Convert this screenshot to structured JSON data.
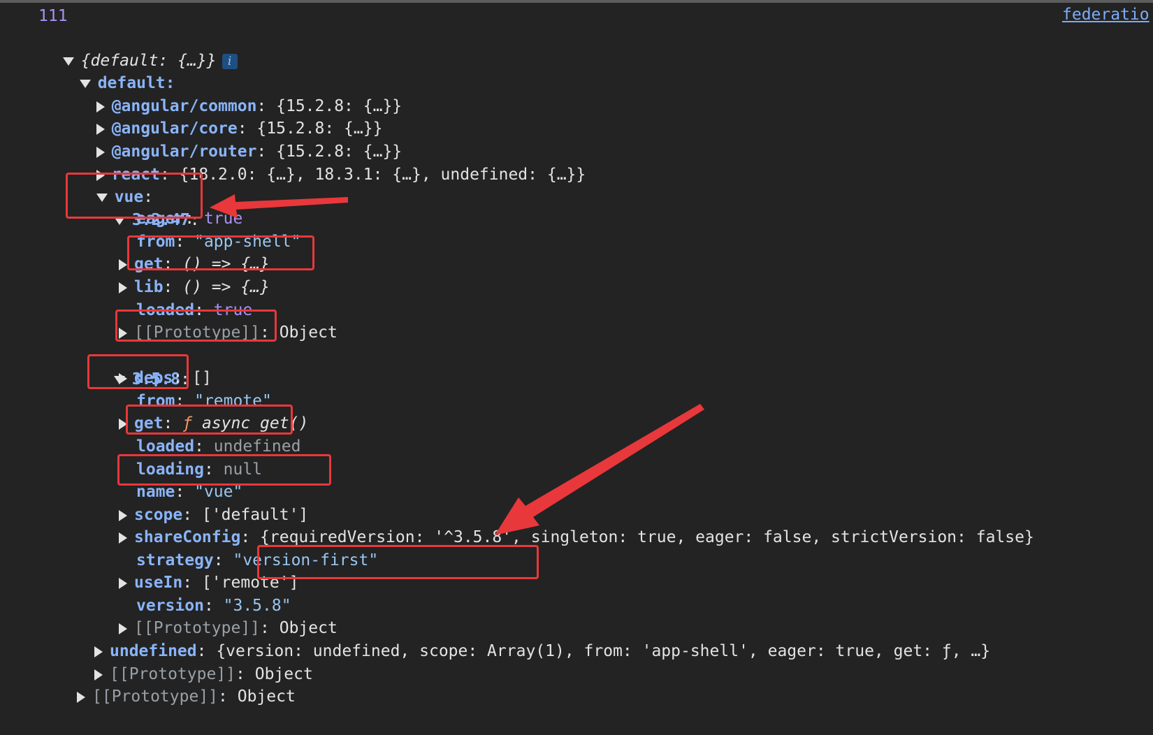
{
  "console": {
    "count": "111",
    "source_link": "federatio",
    "info_badge": "i"
  },
  "lines": [
    {
      "text": "{default: {…}}"
    },
    {
      "text": "default:"
    },
    {
      "key": "@angular/common",
      "value": "{15.2.8: {…}}"
    },
    {
      "key": "@angular/core",
      "value": "{15.2.8: {…}}"
    },
    {
      "key": "@angular/router",
      "value": "{15.2.8: {…}}"
    },
    {
      "key": "react",
      "value": "{18.2.0: {…}, 18.3.1: {…}, undefined: {…}}"
    },
    {
      "key": "vue"
    },
    {
      "key": "3.2.47"
    },
    {
      "key": "eager",
      "value": "true"
    },
    {
      "key": "from",
      "value": "\"app-shell\""
    },
    {
      "key": "get",
      "value": "() => {…}"
    },
    {
      "key": "lib",
      "value": "() => {…}"
    },
    {
      "key": "loaded",
      "value": "true"
    },
    {
      "key": "[[Prototype]]",
      "value": "Object"
    },
    {
      "key": "3.5.8"
    },
    {
      "key": "deps",
      "value": "[]"
    },
    {
      "key": "from",
      "value": "\"remote\""
    },
    {
      "key": "get",
      "value_fn": "ƒ",
      "value": "async get()"
    },
    {
      "key": "loaded",
      "value": "undefined"
    },
    {
      "key": "loading",
      "value": "null"
    },
    {
      "key": "name",
      "value": "\"vue\""
    },
    {
      "key": "scope",
      "value": "['default']"
    },
    {
      "key": "shareConfig",
      "value": "{requiredVersion: '^3.5.8', singleton: true, eager: false, strictVersion: false}"
    },
    {
      "key": "strategy",
      "value": "\"version-first\""
    },
    {
      "key": "useIn",
      "value": "['remote']"
    },
    {
      "key": "version",
      "value": "\"3.5.8\""
    },
    {
      "key": "[[Prototype]]",
      "value": "Object"
    },
    {
      "key": "undefined",
      "value": "{version: undefined, scope: Array(1), from: 'app-shell', eager: true, get: ƒ, …}"
    },
    {
      "key": "[[Prototype]]",
      "value": "Object"
    },
    {
      "key": "[[Prototype]]",
      "value": "Object"
    }
  ],
  "colors": {
    "background": "#232323",
    "key": "#8ab4f8",
    "string": "#98c6f0",
    "boolean": "#a991f5",
    "annotation": "#e8383b"
  }
}
